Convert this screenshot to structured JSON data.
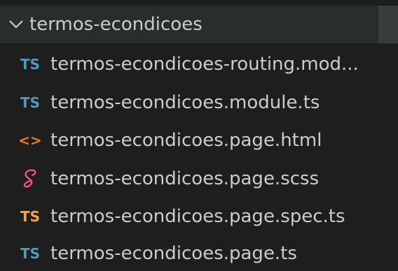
{
  "folder": {
    "name": "termos-econdicoes",
    "icon": "chevron-down-icon"
  },
  "files": [
    {
      "label": "termos-econdicoes-routing.mod...",
      "icon_text": "TS",
      "icon": "typescript-file-icon",
      "color": "#519aba"
    },
    {
      "label": "termos-econdicoes.module.ts",
      "icon_text": "TS",
      "icon": "typescript-file-icon",
      "color": "#519aba"
    },
    {
      "label": "termos-econdicoes.page.html",
      "icon_text": "<>",
      "icon": "html-file-icon",
      "color": "#e37933"
    },
    {
      "label": "termos-econdicoes.page.scss",
      "icon_text": "",
      "icon": "sass-file-icon",
      "color": "#f55385"
    },
    {
      "label": "termos-econdicoes.page.spec.ts",
      "icon_text": "TS",
      "icon": "typescript-test-file-icon",
      "color": "#f0a64b"
    },
    {
      "label": "termos-econdicoes.page.ts",
      "icon_text": "TS",
      "icon": "typescript-file-icon",
      "color": "#519aba"
    }
  ]
}
